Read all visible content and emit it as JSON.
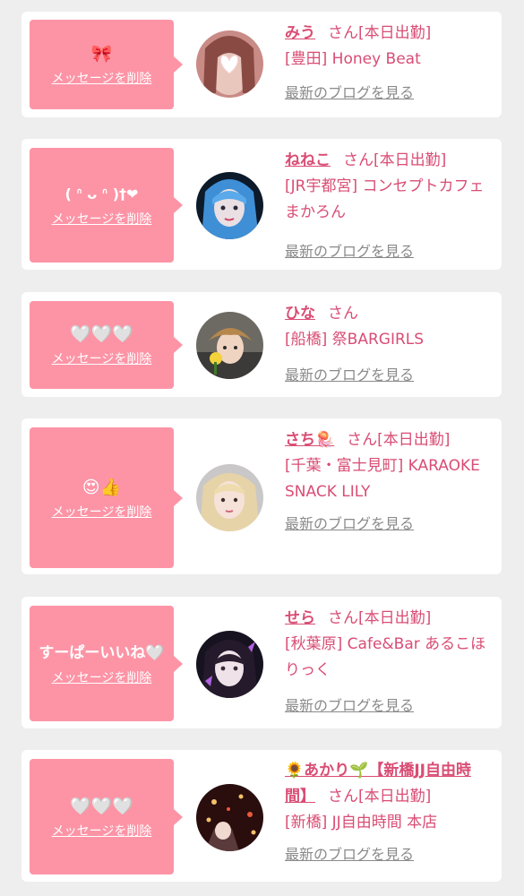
{
  "cards": [
    {
      "message": "🎀",
      "delete_label": "メッセージを削除",
      "name": "みう",
      "honorific": "さん",
      "status": "[本日出勤]",
      "shop": "[豊田] Honey Beat",
      "blog_link": "最新のブログを見る"
    },
    {
      "message": "( ᐢ ᴗ ᐢ )†❤",
      "delete_label": "メッセージを削除",
      "name": "ねねこ",
      "honorific": "さん",
      "status": "[本日出勤]",
      "shop": "[JR宇都宮] コンセプトカフェ まかろん",
      "blog_link": "最新のブログを見る"
    },
    {
      "message": "🤍🤍🤍",
      "delete_label": "メッセージを削除",
      "name": "ひな",
      "honorific": "さん",
      "status": "",
      "shop": "[船橋] 祭BARGIRLS",
      "blog_link": "最新のブログを見る"
    },
    {
      "message": "😍👍",
      "delete_label": "メッセージを削除",
      "name": "さち🪼",
      "honorific": "さん",
      "status": "[本日出勤]",
      "shop": "[千葉・富士見町] KARAOKE SNACK LILY",
      "blog_link": "最新のブログを見る"
    },
    {
      "message": "すーぱーいいね🤍",
      "delete_label": "メッセージを削除",
      "name": "せら",
      "honorific": "さん",
      "status": "[本日出勤]",
      "shop": "[秋葉原] Cafe&Bar あるこほりっく",
      "blog_link": "最新のブログを見る"
    },
    {
      "message": "🤍🤍🤍",
      "delete_label": "メッセージを削除",
      "name": "🌻あかり🌱【新橋JJ自由時間】",
      "honorific": "さん",
      "status": "[本日出勤]",
      "shop": "[新橋] JJ自由時間 本店",
      "blog_link": "最新のブログを見る"
    }
  ]
}
